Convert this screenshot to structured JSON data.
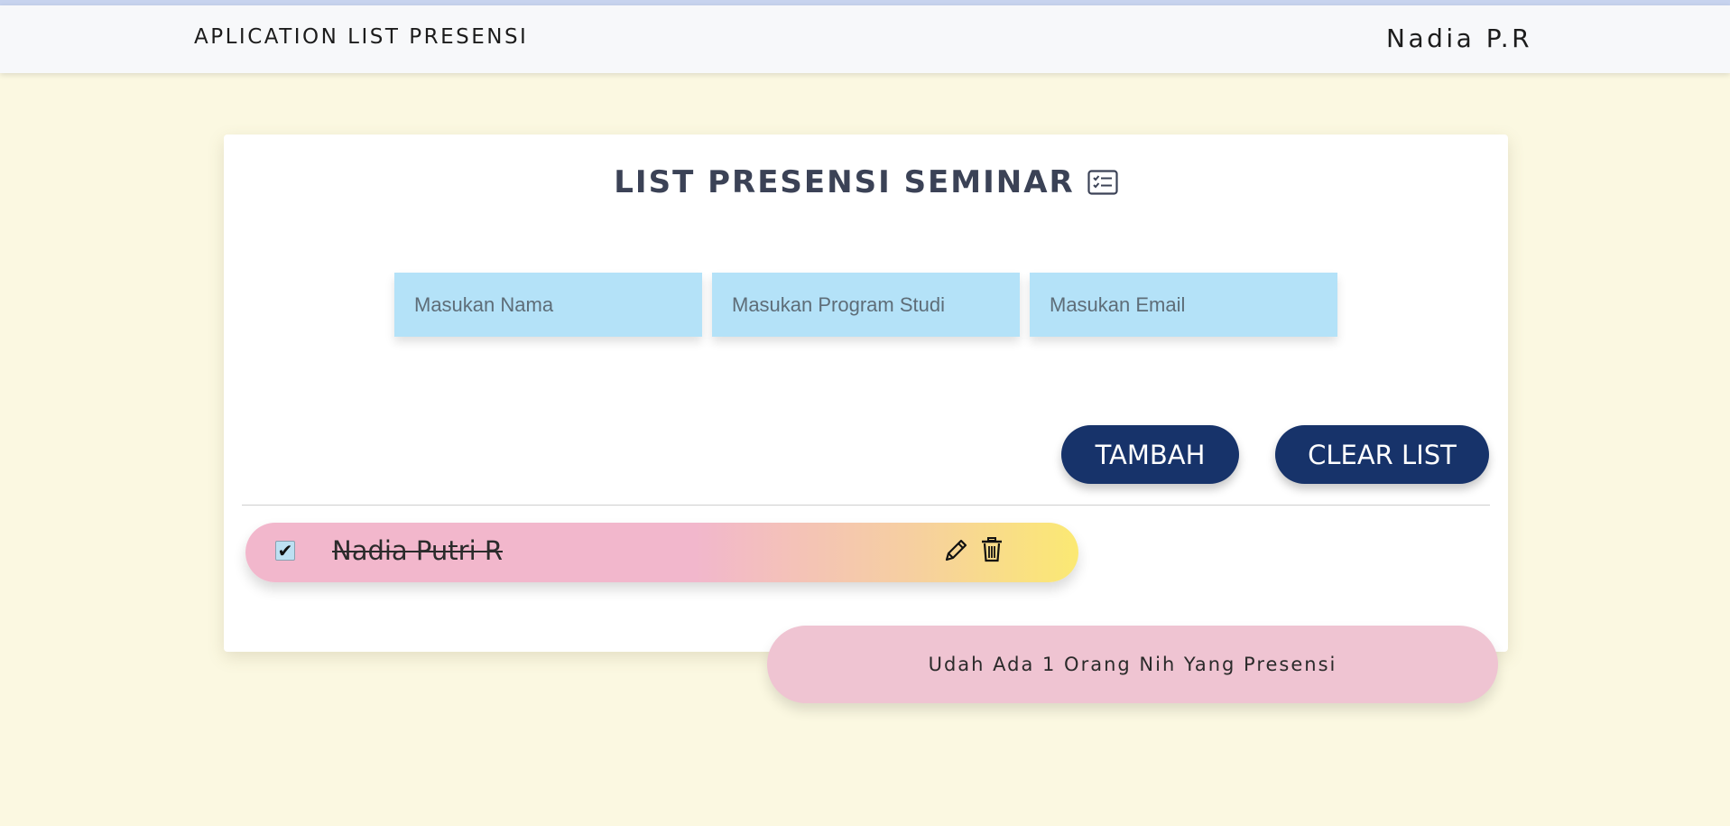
{
  "navbar": {
    "brand": "APLICATION LIST PRESENSI",
    "user": "Nadia P.R"
  },
  "card": {
    "title": "LIST PRESENSI SEMINAR",
    "title_icon": "checklist-card-icon"
  },
  "form": {
    "nama_placeholder": "Masukan Nama",
    "prodi_placeholder": "Masukan Program Studi",
    "email_placeholder": "Masukan Email",
    "nama_value": "",
    "prodi_value": "",
    "email_value": ""
  },
  "buttons": {
    "tambah": "TAMBAH",
    "clear": "CLEAR LIST"
  },
  "list": {
    "items": [
      {
        "name": "Nadia Putri R",
        "checked": true,
        "check_mark": "✔"
      }
    ]
  },
  "toast": {
    "message": "Udah Ada 1 Orang Nih Yang Presensi"
  },
  "colors": {
    "background": "#fbf8e1",
    "button": "#17336a",
    "input": "#b4e2f8",
    "item_gradient_start": "#f2b7cc",
    "item_gradient_end": "#fbe973",
    "toast": "#efc4d2"
  }
}
